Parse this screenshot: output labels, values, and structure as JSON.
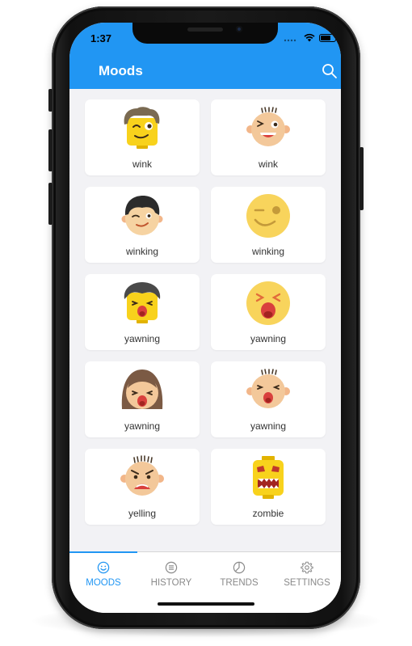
{
  "status_bar": {
    "time": "1:37"
  },
  "app_bar": {
    "title": "Moods",
    "search_icon": "search-icon"
  },
  "moods": [
    {
      "label": "wink",
      "icon": "lego-wink-face-icon"
    },
    {
      "label": "wink",
      "icon": "baby-wink-face-icon"
    },
    {
      "label": "winking",
      "icon": "boy-winking-face-icon"
    },
    {
      "label": "winking",
      "icon": "emoji-winking-face-icon"
    },
    {
      "label": "yawning",
      "icon": "lego-yawning-face-icon"
    },
    {
      "label": "yawning",
      "icon": "emoji-yawning-face-icon"
    },
    {
      "label": "yawning",
      "icon": "girl-yawning-face-icon"
    },
    {
      "label": "yawning",
      "icon": "baby-yawning-face-icon"
    },
    {
      "label": "yelling",
      "icon": "baby-yelling-face-icon"
    },
    {
      "label": "zombie",
      "icon": "lego-zombie-face-icon"
    }
  ],
  "bottom_nav": {
    "items": [
      {
        "label": "MOODS",
        "icon": "smiley-icon",
        "active": true
      },
      {
        "label": "HISTORY",
        "icon": "list-icon",
        "active": false
      },
      {
        "label": "TRENDS",
        "icon": "pie-chart-icon",
        "active": false
      },
      {
        "label": "SETTINGS",
        "icon": "gear-icon",
        "active": false
      }
    ]
  },
  "colors": {
    "primary": "#2196f3",
    "screen_background": "#f2f2f5",
    "card_background": "#ffffff",
    "inactive_nav": "#8a8a8a",
    "emoji_yellow": "#f8c534",
    "skin": "#f3c89a",
    "mouth_red": "#d9403d"
  }
}
